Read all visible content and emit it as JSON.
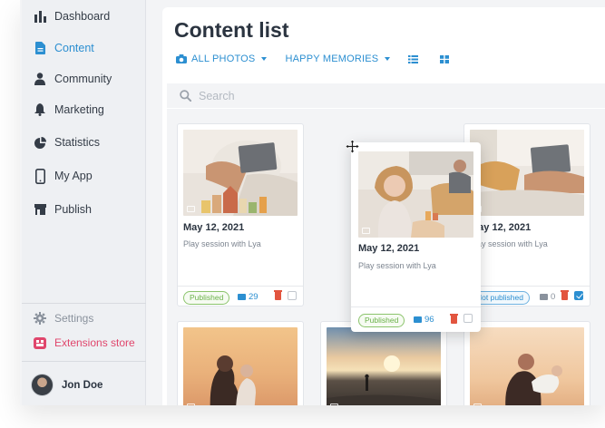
{
  "sidebar": {
    "items": [
      {
        "label": "Dashboard",
        "icon": "bar-chart-icon",
        "active": false
      },
      {
        "label": "Content",
        "icon": "document-icon",
        "active": true
      },
      {
        "label": "Community",
        "icon": "person-icon",
        "active": false
      },
      {
        "label": "Marketing",
        "icon": "bell-icon",
        "active": false
      },
      {
        "label": "Statistics",
        "icon": "pie-chart-icon",
        "active": false
      },
      {
        "label": "My App",
        "icon": "phone-icon",
        "active": false
      },
      {
        "label": "Publish",
        "icon": "storefront-icon",
        "active": false
      }
    ],
    "settings_label": "Settings",
    "extensions_label": "Extensions store",
    "user_name": "Jon Doe"
  },
  "main": {
    "title": "Content list",
    "filter_photos": "ALL PHOTOS",
    "filter_album": "HAPPY MEMORIES",
    "search_placeholder": "Search"
  },
  "cards": [
    {
      "date": "May 12, 2021",
      "desc": "Play session with Lya",
      "status": "Published",
      "comments": "29",
      "checked": false
    },
    {
      "date": "May 12, 2021",
      "desc": "Play session with Lya",
      "status": "Not published",
      "comments": "0",
      "checked": true
    },
    {
      "date": "May 12, 2021",
      "desc": "Play session with Lya",
      "status": "Published",
      "comments": "96",
      "checked": false
    }
  ],
  "colors": {
    "accent": "#2c8fd1",
    "published": "#6bb24a",
    "delete": "#e2553f",
    "extensions": "#e0466c"
  }
}
